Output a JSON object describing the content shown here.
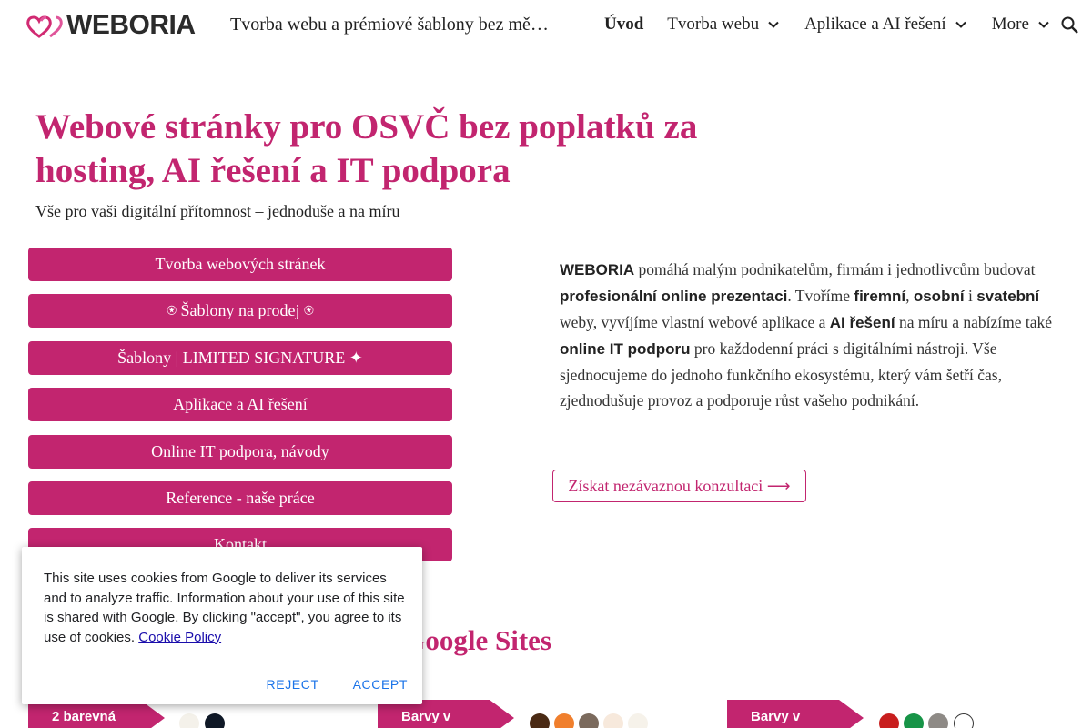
{
  "header": {
    "logo_text": "WEBORIA",
    "site_title": "Tvorba webu a prémiové šablony bez měsíčních poplatků",
    "nav": [
      {
        "label": "Úvod",
        "active": true,
        "has_dropdown": false
      },
      {
        "label": "Tvorba webu",
        "active": false,
        "has_dropdown": true
      },
      {
        "label": "Aplikace a AI řešení",
        "active": false,
        "has_dropdown": true
      },
      {
        "label": "More",
        "active": false,
        "has_dropdown": true
      }
    ],
    "search_icon": "search-icon"
  },
  "hero": {
    "title": "Webové stránky pro OSVČ bez poplatků za hosting, AI řešení a IT podpora",
    "subtitle": "Vše pro vaši digitální přítomnost – jednoduše a na míru"
  },
  "buttons": [
    "Tvorba webových stránek",
    "⍟ Šablony na prodej ⍟",
    "Šablony | LIMITED SIGNATURE ✦",
    "Aplikace a AI řešení",
    "Online IT podpora, návody",
    "Reference - naše práce",
    "Kontakt"
  ],
  "intro": {
    "p1": "WEBORIA",
    "p2": " pomáhá malým podnikatelům, firmám i jednotlivcům budovat ",
    "p3": "profesionální online prezentaci",
    "p4": ". Tvoříme ",
    "p5": "firemní",
    "p6": ", ",
    "p7": "osobní",
    "p8": " i ",
    "p9": "svatební",
    "p10": " weby, vyvíjíme vlastní webové aplikace a ",
    "p11": "AI řešení",
    "p12": " na míru a nabízíme také ",
    "p13": "online IT podporu",
    "p14": " pro každodenní práci s digitálními nástroji. Vše sjednocujeme do jednoho funkčního ekosystému, který vám šetří čas, zjednodušuje provoz a podporuje růst vašeho podnikání."
  },
  "cta_label": "Získat nezávaznou konzultaci ⟶",
  "section_heading": "y Google Sites",
  "cards": [
    {
      "tag": "2 barevná"
    },
    {
      "tag": "Barvy v"
    },
    {
      "tag": "Barvy v"
    }
  ],
  "swatches": {
    "card1": [
      "#f4f1ea",
      "#0f1826"
    ],
    "card2": [
      "#4a2a14",
      "#f07f2d",
      "#7b6a5d",
      "#f7e9dc",
      "#f6f2ea"
    ],
    "card3": [
      "#c81e1e",
      "#179447",
      "#8e8a86",
      "#ffffff"
    ]
  },
  "cookie": {
    "text": "This site uses cookies from Google to deliver its services and to analyze traffic. Information about your use of this site is shared with Google. By clicking \"accept\", you agree to its use of cookies. ",
    "link": "Cookie Policy",
    "reject": "REJECT",
    "accept": "ACCEPT"
  },
  "colors": {
    "accent": "#c2256f",
    "link": "#1a0dab",
    "dialog_button": "#1a73e8"
  }
}
